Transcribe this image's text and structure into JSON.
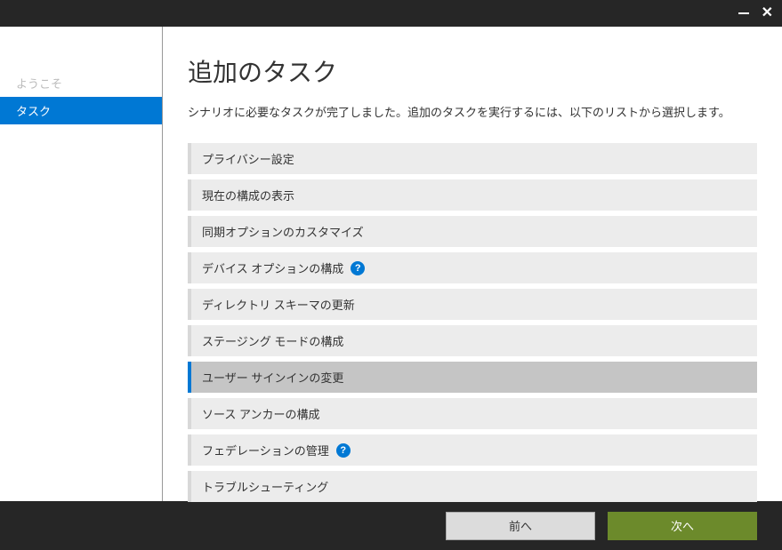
{
  "sidebar": {
    "items": [
      {
        "label": "ようこそ",
        "state": "disabled"
      },
      {
        "label": "タスク",
        "state": "active"
      }
    ]
  },
  "page": {
    "title": "追加のタスク",
    "description": "シナリオに必要なタスクが完了しました。追加のタスクを実行するには、以下のリストから選択します。"
  },
  "tasks": [
    {
      "label": "プライバシー設定",
      "help": false,
      "selected": false
    },
    {
      "label": "現在の構成の表示",
      "help": false,
      "selected": false
    },
    {
      "label": "同期オプションのカスタマイズ",
      "help": false,
      "selected": false
    },
    {
      "label": "デバイス オプションの構成",
      "help": true,
      "selected": false
    },
    {
      "label": "ディレクトリ スキーマの更新",
      "help": false,
      "selected": false
    },
    {
      "label": "ステージング モードの構成",
      "help": false,
      "selected": false
    },
    {
      "label": "ユーザー サインインの変更",
      "help": false,
      "selected": true
    },
    {
      "label": "ソース アンカーの構成",
      "help": false,
      "selected": false
    },
    {
      "label": "フェデレーションの管理",
      "help": true,
      "selected": false
    },
    {
      "label": "トラブルシューティング",
      "help": false,
      "selected": false
    }
  ],
  "footer": {
    "back": "前へ",
    "next": "次へ"
  },
  "help_glyph": "?"
}
